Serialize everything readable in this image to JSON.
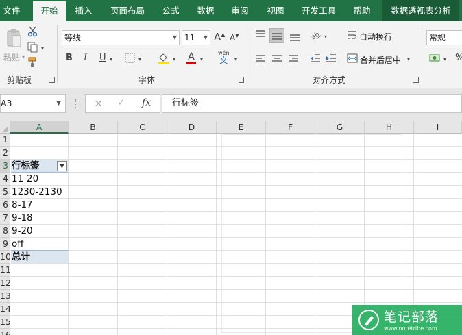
{
  "tabs": [
    "文件",
    "开始",
    "插入",
    "页面布局",
    "公式",
    "数据",
    "审阅",
    "视图",
    "开发工具",
    "帮助",
    "数据透视表分析"
  ],
  "active_tab": "开始",
  "ribbon": {
    "clipboard": {
      "paste": "粘贴",
      "group": "剪贴板"
    },
    "font": {
      "name": "等线",
      "size": "11",
      "grow": "A",
      "shrink": "A",
      "bold": "B",
      "italic": "I",
      "underline": "U",
      "font_color": "A",
      "phonetic": "wén",
      "phonetic_char": "文",
      "group": "字体"
    },
    "alignment": {
      "wrap": "自动换行",
      "merge": "合并后居中",
      "group": "对齐方式"
    },
    "number": {
      "format": "常规",
      "percent": "%"
    }
  },
  "formula_bar": {
    "name_box": "A3",
    "cancel": "×",
    "enter": "✓",
    "fx": "fx",
    "content": "行标签"
  },
  "columns": [
    "A",
    "B",
    "C",
    "D",
    "E",
    "F",
    "G",
    "H",
    "I"
  ],
  "rows": [
    "1",
    "2",
    "3",
    "4",
    "5",
    "6",
    "7",
    "8",
    "9",
    "10",
    "11",
    "12",
    "13",
    "14",
    "15",
    "16"
  ],
  "cells": {
    "a3": "行标签",
    "a4": "11-20",
    "a5": "1230-2130",
    "a6": "8-17",
    "a7": "9-18",
    "a8": "9-20",
    "a9": "off",
    "a10": "总计"
  },
  "watermark": {
    "title": "笔记部落",
    "url": "www.notetribe.com"
  },
  "colors": {
    "accent": "#217346",
    "pivot_fill": "#dce6f1",
    "watermark": "#27ae60"
  }
}
